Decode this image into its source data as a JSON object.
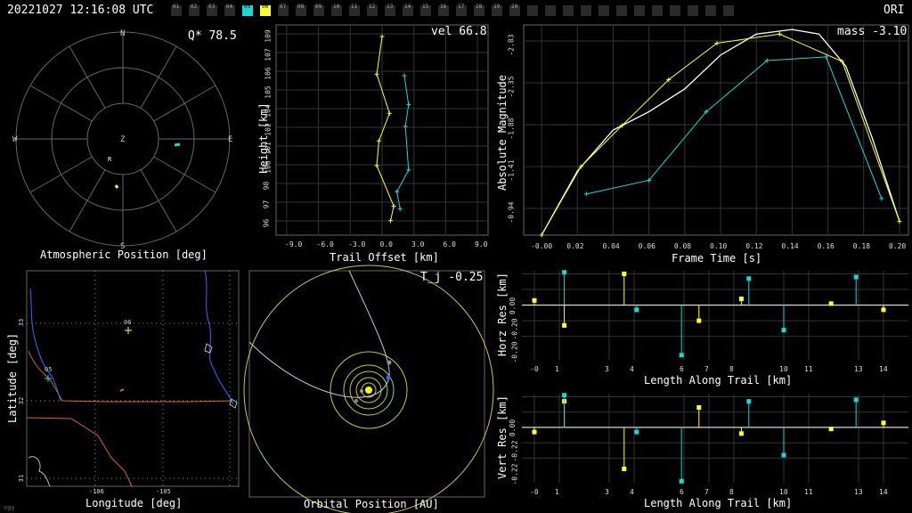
{
  "header": {
    "datetime": "20221027 12:16:08 UTC",
    "shower_code": "ORI",
    "cameras": [
      {
        "id": "01",
        "state": "off"
      },
      {
        "id": "02",
        "state": "off"
      },
      {
        "id": "03",
        "state": "off"
      },
      {
        "id": "04",
        "state": "off"
      },
      {
        "id": "05",
        "state": "cyan"
      },
      {
        "id": "06",
        "state": "yellow"
      },
      {
        "id": "07",
        "state": "off"
      },
      {
        "id": "08",
        "state": "off"
      },
      {
        "id": "09",
        "state": "off"
      },
      {
        "id": "10",
        "state": "off"
      },
      {
        "id": "11",
        "state": "off"
      },
      {
        "id": "12",
        "state": "off"
      },
      {
        "id": "13",
        "state": "off"
      },
      {
        "id": "14",
        "state": "off"
      },
      {
        "id": "15",
        "state": "off"
      },
      {
        "id": "16",
        "state": "off"
      },
      {
        "id": "17",
        "state": "off"
      },
      {
        "id": "18",
        "state": "off"
      },
      {
        "id": "19",
        "state": "off"
      },
      {
        "id": "20",
        "state": "off"
      },
      {
        "id": "",
        "state": "off"
      },
      {
        "id": "",
        "state": "off"
      },
      {
        "id": "",
        "state": "off"
      },
      {
        "id": "",
        "state": "off"
      },
      {
        "id": "",
        "state": "off"
      },
      {
        "id": "",
        "state": "off"
      },
      {
        "id": "",
        "state": "off"
      },
      {
        "id": "",
        "state": "off"
      },
      {
        "id": "",
        "state": "off"
      },
      {
        "id": "",
        "state": "off"
      },
      {
        "id": "",
        "state": "off"
      },
      {
        "id": "",
        "state": "off"
      }
    ]
  },
  "colors": {
    "cam05": "#1fd6d6",
    "cam06": "#ffff33",
    "grid": "#555",
    "fit": "#ffffff",
    "orbit": "#c8c83a",
    "map_coast": "#3a6aff",
    "map_border": "#d06a2a"
  },
  "atmos": {
    "title": "Atmospheric Position [deg]",
    "q_label": "Q* 78.5",
    "dirs": {
      "n": "N",
      "s": "S",
      "e": "E",
      "w": "W",
      "z": "Z"
    },
    "radiant_marker": "R"
  },
  "trail": {
    "vel_label": "vel 66.8",
    "xlabel": "Trail Offset [km]",
    "ylabel": "Height [km]",
    "xticks": [
      "-9.0",
      "-6.0",
      "-3.0",
      "0.0",
      "3.0",
      "6.0",
      "9.0"
    ],
    "yticks": [
      "109",
      "107",
      "106",
      "105",
      "104",
      "102",
      "101",
      "100",
      "98",
      "97",
      "96"
    ]
  },
  "mag": {
    "mass_label": "mass -3.10",
    "xlabel": "Frame Time [s]",
    "ylabel": "Absolute Magnitude",
    "xticks": [
      "-0.00",
      "0.02",
      "0.04",
      "0.06",
      "0.08",
      "0.10",
      "0.12",
      "0.14",
      "0.16",
      "0.18",
      "0.20"
    ],
    "yticks": [
      "-2.83",
      "-2.35",
      "-1.88",
      "-1.41",
      "-0.94"
    ]
  },
  "map": {
    "xlabel": "Longitude [deg]",
    "ylabel": "Latitude [deg]",
    "xticks": [
      "-106",
      "-105"
    ],
    "yticks": [
      "33",
      "32",
      "31"
    ],
    "stations": [
      {
        "id": "06"
      },
      {
        "id": "05"
      }
    ],
    "corner_text": "ogy"
  },
  "orbit": {
    "tj_label": "T_j -0.25",
    "xlabel": "Orbital Position [AU]"
  },
  "horz": {
    "ylabel": "Horz Res [km]",
    "xlabel": "Length Along Trail [km]",
    "yticks": [
      "0.00",
      "-0.20",
      "-0.20"
    ],
    "xticks": [
      "-0",
      "1",
      "3",
      "4",
      "6",
      "7",
      "8",
      "10",
      "11",
      "13",
      "14"
    ]
  },
  "vert": {
    "ylabel": "Vert Res [km]",
    "xlabel": "Length Along Trail [km]",
    "yticks": [
      "0.00",
      "-0.22",
      "-0.22"
    ],
    "xticks": [
      "-0",
      "1",
      "3",
      "4",
      "6",
      "7",
      "8",
      "10",
      "11",
      "13",
      "14"
    ]
  },
  "chart_data": [
    {
      "type": "line",
      "title": "",
      "xlabel": "Frame Time [s]",
      "ylabel": "Absolute Magnitude",
      "xlim": [
        -0.01,
        0.205
      ],
      "ylim": [
        -0.75,
        -3.05
      ],
      "series": [
        {
          "name": "06",
          "x": [
            0.0,
            0.022,
            0.045,
            0.071,
            0.098,
            0.133,
            0.168,
            0.2
          ],
          "y": [
            -0.75,
            -1.5,
            -1.95,
            -2.45,
            -2.85,
            -2.95,
            -2.65,
            -0.9
          ]
        },
        {
          "name": "05",
          "x": [
            0.025,
            0.06,
            0.092,
            0.126,
            0.159,
            0.19
          ],
          "y": [
            -1.2,
            -1.35,
            -2.1,
            -2.66,
            -2.7,
            -1.15
          ]
        },
        {
          "name": "fit",
          "x": [
            0.0,
            0.02,
            0.04,
            0.06,
            0.08,
            0.1,
            0.12,
            0.14,
            0.155,
            0.17,
            0.185,
            0.2
          ],
          "y": [
            -0.75,
            -1.45,
            -1.9,
            -2.1,
            -2.35,
            -2.72,
            -2.95,
            -3.0,
            -2.95,
            -2.6,
            -1.8,
            -0.9
          ]
        }
      ]
    },
    {
      "type": "line",
      "title": "",
      "xlabel": "Trail Offset [km]",
      "ylabel": "Height [km]",
      "xlim": [
        -10,
        10
      ],
      "ylim": [
        95.5,
        110
      ],
      "series": [
        {
          "name": "06",
          "x": [
            0.0,
            -0.5,
            0.7,
            -0.3,
            -0.5,
            1.1,
            0.8
          ],
          "y": [
            109.2,
            106.6,
            103.9,
            102.0,
            100.3,
            97.5,
            96.5
          ]
        },
        {
          "name": "05",
          "x": [
            2.1,
            2.5,
            2.2,
            2.5,
            1.4,
            1.7
          ],
          "y": [
            106.5,
            104.5,
            103.0,
            100.0,
            98.5,
            97.3
          ]
        }
      ]
    },
    {
      "type": "scatter",
      "title": "",
      "xlabel": "Length Along Trail [km]",
      "ylabel": "Horz Res [km]",
      "xlim": [
        -0.5,
        15
      ],
      "ylim": [
        -0.35,
        0.22
      ],
      "series": [
        {
          "name": "06",
          "x": [
            0.0,
            1.2,
            3.6,
            6.6,
            8.3,
            11.9,
            14.0
          ],
          "y": [
            0.03,
            -0.13,
            0.2,
            -0.1,
            0.04,
            0.01,
            -0.03
          ]
        },
        {
          "name": "05",
          "x": [
            1.2,
            4.1,
            5.9,
            8.6,
            10.0,
            12.9
          ],
          "y": [
            0.21,
            -0.03,
            -0.32,
            0.17,
            -0.16,
            0.18
          ]
        }
      ]
    },
    {
      "type": "scatter",
      "title": "",
      "xlabel": "Length Along Trail [km]",
      "ylabel": "Vert Res [km]",
      "xlim": [
        -0.5,
        15
      ],
      "ylim": [
        -0.36,
        0.22
      ],
      "series": [
        {
          "name": "06",
          "x": [
            0.0,
            1.2,
            3.6,
            6.6,
            8.3,
            11.9,
            14.0
          ],
          "y": [
            -0.03,
            0.17,
            -0.27,
            0.13,
            -0.04,
            -0.01,
            0.03
          ]
        },
        {
          "name": "05",
          "x": [
            1.2,
            4.1,
            5.9,
            8.6,
            10.0,
            12.9
          ],
          "y": [
            0.21,
            -0.03,
            -0.35,
            0.17,
            -0.18,
            0.18
          ]
        }
      ]
    }
  ]
}
